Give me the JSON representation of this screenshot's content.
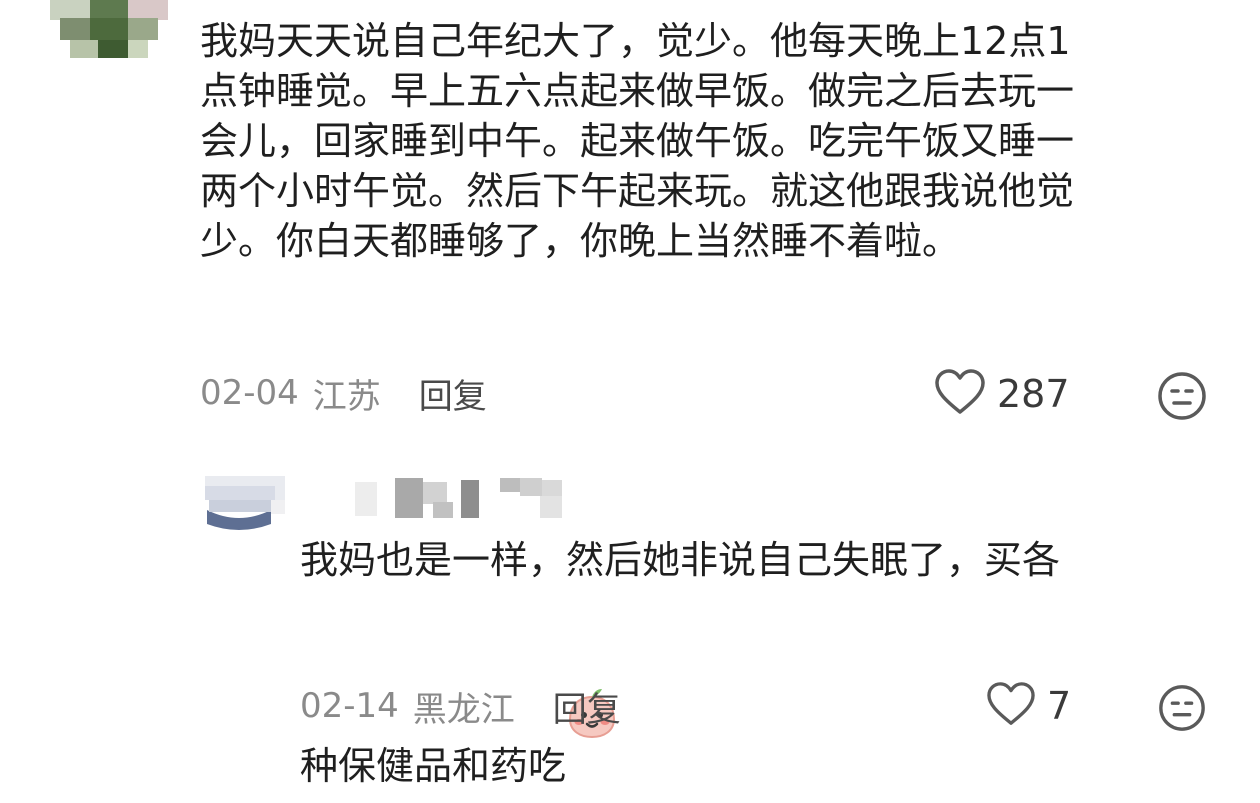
{
  "comments": [
    {
      "text": "我妈天天说自己年纪大了，觉少。他每天晚上12点1点钟睡觉。早上五六点起来做早饭。做完之后去玩一会儿，回家睡到中午。起来做午饭。吃完午饭又睡一两个小时午觉。然后下午起来玩。就这他跟我说他觉少。你白天都睡够了，你晚上当然睡不着啦。",
      "lines": [
        "我妈天天说自己年纪大了，觉少。他每天晚上12点1",
        "点钟睡觉。早上五六点起来做早饭。做完之后去玩一",
        "会儿，回家睡到中午。起来做午饭。吃完午饭又睡一",
        "两个小时午觉。然后下午起来玩。就这他跟我说他觉",
        "少。你白天都睡够了，你晚上当然睡不着啦。"
      ],
      "date": "02-04",
      "location": "江苏",
      "reply_label": "回复",
      "likes": "287"
    },
    {
      "lines": [
        "我妈也是一样，然后她非说自己失眠了，买各",
        "种保健品和药吃"
      ],
      "date": "02-14",
      "location": "黑龙江",
      "reply_label": "回复",
      "likes": "7",
      "emoji": "peach-face-emoji"
    }
  ],
  "icons": {
    "like": "heart-outline-icon",
    "dislike": "neutral-face-icon"
  },
  "colors": {
    "text": "#1f1f1f",
    "meta": "#8a8a8a",
    "icon": "#5a5a5a"
  }
}
